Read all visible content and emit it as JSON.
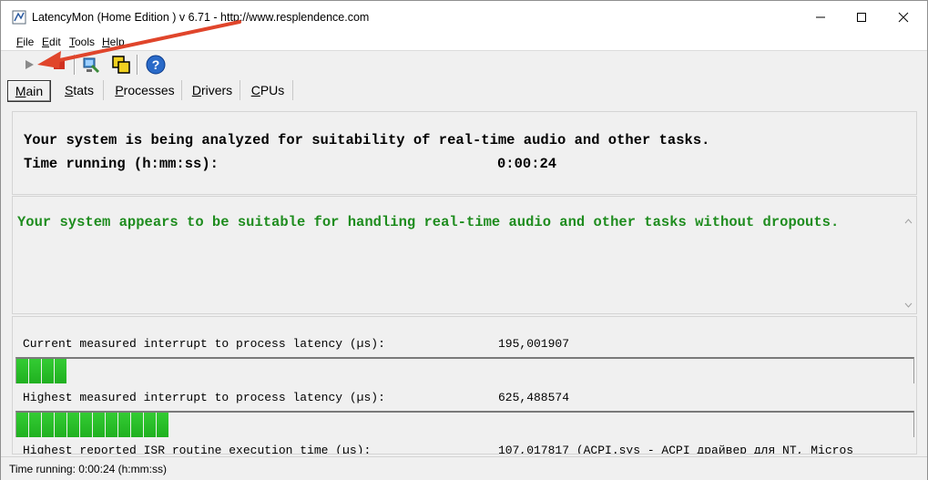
{
  "window": {
    "title": "LatencyMon  (Home Edition )  v 6.71 - http://www.resplendence.com"
  },
  "menu": {
    "items": [
      {
        "key": "F",
        "rest": "ile"
      },
      {
        "key": "E",
        "rest": "dit"
      },
      {
        "key": "T",
        "rest": "ools"
      },
      {
        "key": "H",
        "rest": "elp"
      }
    ]
  },
  "toolbar": {
    "buttons": [
      "play-icon",
      "stop-icon",
      "analyze-icon",
      "copy-icon",
      "help-icon"
    ]
  },
  "tabs": [
    {
      "key": "M",
      "rest": "ain"
    },
    {
      "key": "S",
      "rest": "tats"
    },
    {
      "key": "P",
      "rest": "rocesses"
    },
    {
      "key": "D",
      "rest": "rivers"
    },
    {
      "key": "C",
      "rest": "PUs"
    }
  ],
  "analysis": {
    "line1": "Your system is being analyzed for suitability of real-time audio and other tasks.",
    "time_label": "Time running (h:mm:ss):",
    "time_value": "0:00:24"
  },
  "verdict": {
    "text": "Your system appears to be suitable for handling real-time audio and other tasks without dropouts."
  },
  "metrics": [
    {
      "label": "Current measured interrupt to process latency (µs):",
      "value": "195,001907",
      "bar_segments": 4
    },
    {
      "label": "Highest measured interrupt to process latency (µs):",
      "value": "625,488574",
      "bar_segments": 12
    },
    {
      "label": "Highest reported ISR routine execution time (µs):",
      "value": "107,017817   (ACPI.sys - ACPI драйвер для NT, Micros"
    }
  ],
  "status": {
    "text": "Time running: 0:00:24  (h:mm:ss)"
  },
  "colors": {
    "verdict_green": "#1e8c1e",
    "bar_green": "#22b422",
    "annotation_red": "#e0452b"
  }
}
